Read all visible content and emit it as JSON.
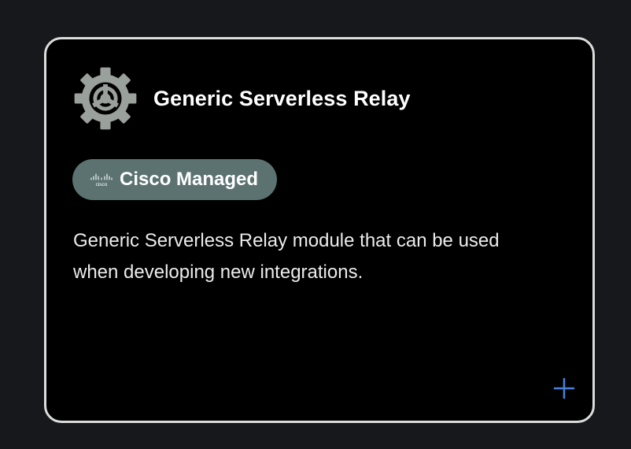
{
  "card": {
    "title": "Generic Serverless Relay",
    "icon": "gear-icon",
    "badge": {
      "logo_text": "cisco",
      "label": "Cisco Managed",
      "color": "#5b7271"
    },
    "description": "Generic Serverless Relay module that can be used when developing new integrations.",
    "add_icon": "plus-icon",
    "accent_color": "#4a7fd6"
  }
}
